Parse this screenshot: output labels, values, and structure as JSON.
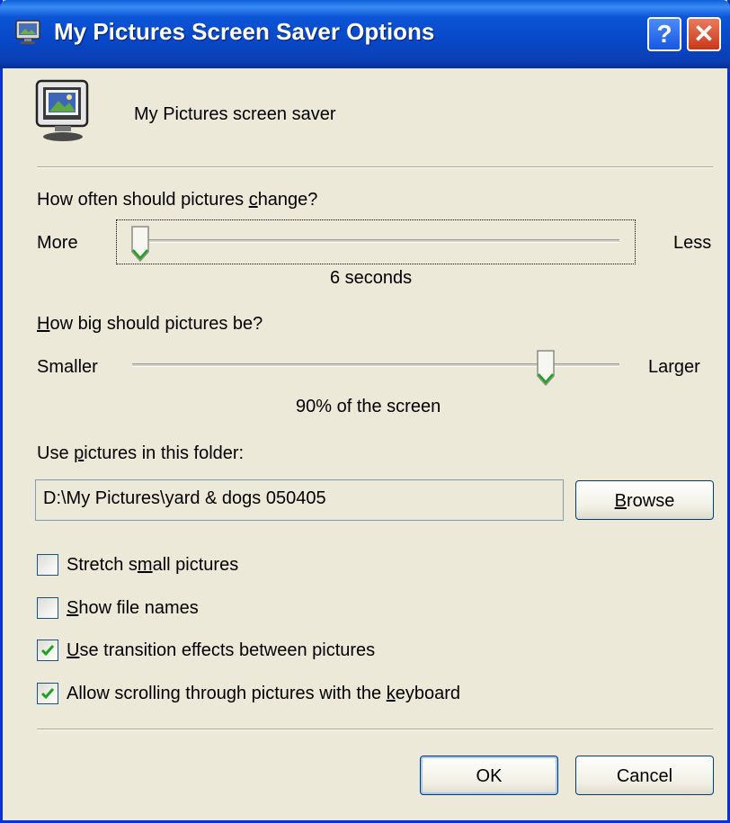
{
  "window": {
    "title": "My Pictures Screen Saver Options",
    "help_button": "?",
    "close_button": "✕"
  },
  "header": {
    "description": "My Pictures screen saver"
  },
  "change_interval": {
    "label": "How often should pictures change?",
    "left_label": "More",
    "right_label": "Less",
    "value_text": "6 seconds",
    "slider_fraction": 0.0
  },
  "picture_size": {
    "label": "How big should pictures be?",
    "left_label": "Smaller",
    "right_label": "Larger",
    "value_text": "90% of the screen",
    "slider_fraction": 0.85
  },
  "folder": {
    "label": "Use pictures in this folder:",
    "path": "D:\\My Pictures\\yard & dogs 050405",
    "browse_label": "Browse"
  },
  "options": [
    {
      "label": "Stretch small pictures",
      "checked": false
    },
    {
      "label": "Show file names",
      "checked": false
    },
    {
      "label": "Use transition effects between pictures",
      "checked": true
    },
    {
      "label": "Allow scrolling through pictures with the keyboard",
      "checked": true
    }
  ],
  "buttons": {
    "ok": "OK",
    "cancel": "Cancel"
  },
  "colors": {
    "title_bar": "#0a47c7",
    "dialog_bg": "#ece9d8",
    "checkmark": "#21a121"
  }
}
